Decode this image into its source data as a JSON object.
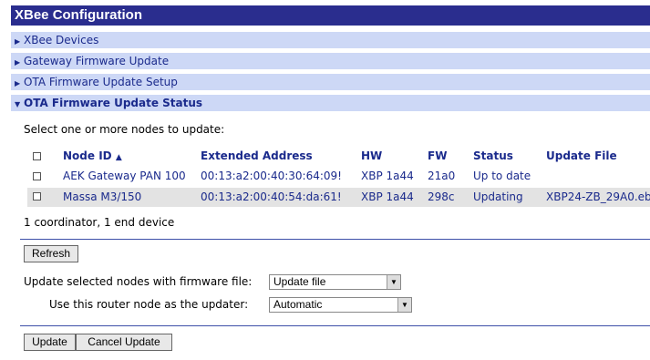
{
  "title": "XBee Configuration",
  "sections": [
    {
      "label": "XBee Devices"
    },
    {
      "label": "Gateway Firmware Update"
    },
    {
      "label": "OTA Firmware Update Setup"
    },
    {
      "label": "OTA Firmware Update Status"
    }
  ],
  "prompt": "Select one or more nodes to update:",
  "table": {
    "headers": {
      "node_id": "Node ID",
      "sort_icon": "▲",
      "extended_address": "Extended Address",
      "hw": "HW",
      "fw": "FW",
      "status": "Status",
      "update_file": "Update File"
    },
    "rows": [
      {
        "node_id": "AEK Gateway PAN 100",
        "extended_address": "00:13:a2:00:40:30:64:09!",
        "hw": "XBP 1a44",
        "fw": "21a0",
        "status": "Up to date",
        "update_file": ""
      },
      {
        "node_id": "Massa M3/150",
        "extended_address": "00:13:a2:00:40:54:da:61!",
        "hw": "XBP 1a44",
        "fw": "298c",
        "status": "Updating",
        "update_file": "XBP24-ZB_29A0.eb"
      }
    ],
    "summary": "1 coordinator, 1 end device"
  },
  "buttons": {
    "refresh": "Refresh",
    "update": "Update",
    "cancel_update": "Cancel Update"
  },
  "firmware_file": {
    "label": "Update selected nodes with firmware file:",
    "selected": "Update file"
  },
  "router": {
    "label": "Use this router node as the updater:",
    "selected": "Automatic"
  },
  "colors": {
    "title_bg": "#2a2d8e",
    "section_bg": "#cdd8f6",
    "link": "#1a2a8c"
  }
}
